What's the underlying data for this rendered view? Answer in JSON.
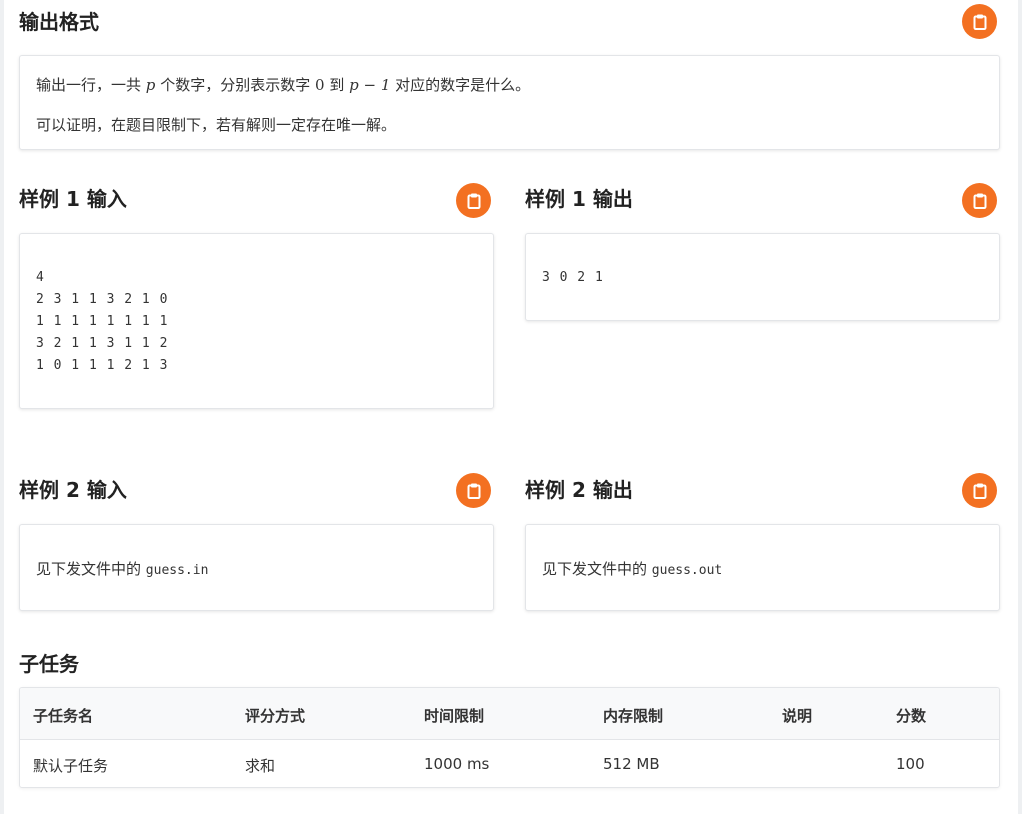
{
  "output_format": {
    "title": "输出格式",
    "line1_a": "输出一行，一共",
    "var_p": "p",
    "line1_b": "个数字，分别表示数字",
    "zero": "0",
    "line1_c": "到",
    "p_minus_1": "p − 1",
    "line1_d": "对应的数字是什么。",
    "line2": "可以证明，在题目限制下，若有解则一定存在唯一解。"
  },
  "sample1": {
    "input_title": "样例 1 输入",
    "input_text": "4\n2 3 1 1 3 2 1 0\n1 1 1 1 1 1 1 1\n3 2 1 1 3 1 1 2\n1 0 1 1 1 2 1 3",
    "output_title": "样例 1 输出",
    "output_text": "3 0 2 1"
  },
  "sample2": {
    "input_title": "样例 2 输入",
    "input_prefix": "见下发文件中的",
    "input_file": "guess.in",
    "output_title": "样例 2 输出",
    "output_prefix": "见下发文件中的",
    "output_file": "guess.out"
  },
  "subtasks": {
    "title": "子任务",
    "headers": [
      "子任务名",
      "评分方式",
      "时间限制",
      "内存限制",
      "说明",
      "分数"
    ],
    "rows": [
      [
        "默认子任务",
        "求和",
        "1000 ms",
        "512 MB",
        "",
        "100"
      ]
    ]
  },
  "icons": {
    "copy": "clipboard-icon"
  },
  "colors": {
    "accent": "#f37021",
    "border": "#e3e5e8",
    "header_bg": "#f8f9fa"
  }
}
